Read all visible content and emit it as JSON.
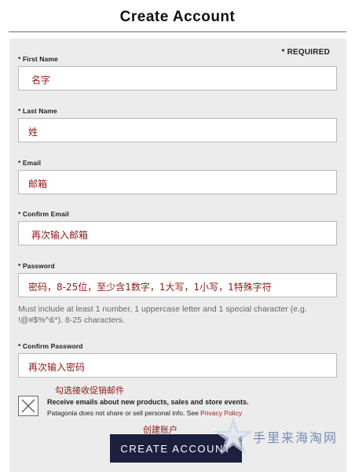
{
  "header": {
    "title": "Create Account"
  },
  "form": {
    "required_note": "* REQUIRED",
    "fields": [
      {
        "label": "* First Name",
        "value": "名字"
      },
      {
        "label": "* Last Name",
        "value": "姓"
      },
      {
        "label": "* Email",
        "value": "邮箱"
      },
      {
        "label": "* Confirm Email",
        "value": "再次输入邮箱"
      },
      {
        "label": "* Password",
        "value": "密码，8-25位，至少含1数字，1大写，1小写，1特殊字符"
      },
      {
        "label": "* Confirm Password",
        "value": "再次输入密码"
      }
    ],
    "password_help": "Must include at least 1 number, 1 uppercase letter and 1 special character (e.g. !@#$%^&*). 8-25 characters.",
    "opt_in": {
      "label": "Receive emails about new products, sales and store events.",
      "privacy_text": "Patagonia does not share or sell personal info. See",
      "privacy_link": "Privacy Policy"
    },
    "submit_label": "CREATE ACCOUNT"
  },
  "annotations": {
    "checkbox_note": "勾选接收促销邮件",
    "submit_note": "创建账户"
  },
  "watermark": {
    "text": "手里来海淘网"
  },
  "colors": {
    "panel_bg": "#ececec",
    "button_bg": "#1d1f3f",
    "annotation_red": "#8b1a1a",
    "link_red": "#a11f1f"
  }
}
